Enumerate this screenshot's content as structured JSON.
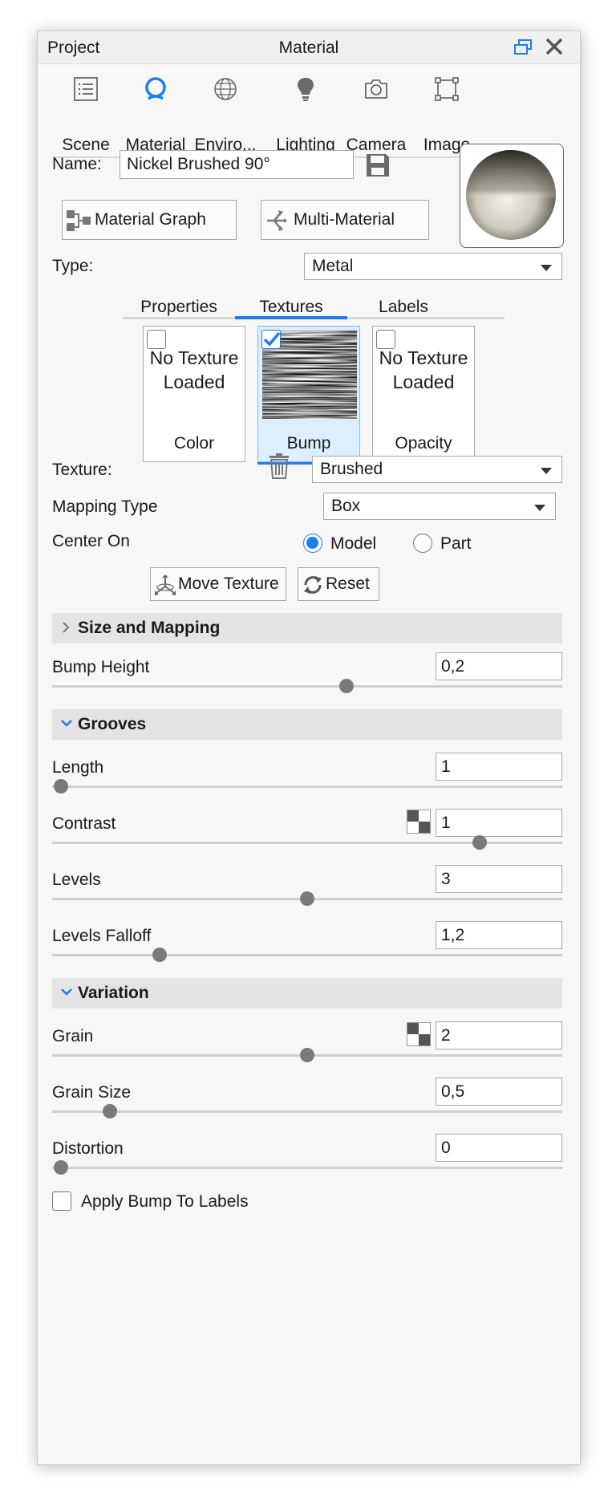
{
  "titlebar": {
    "left": "Project",
    "center": "Material"
  },
  "tabs": [
    {
      "label": "Scene",
      "icon": "list-icon"
    },
    {
      "label": "Material",
      "icon": "material-ring-icon",
      "active": true
    },
    {
      "label": "Enviro...",
      "icon": "globe-icon"
    },
    {
      "label": "Lighting",
      "icon": "lightbulb-icon"
    },
    {
      "label": "Camera",
      "icon": "camera-icon"
    },
    {
      "label": "Image",
      "icon": "image-frame-icon"
    }
  ],
  "name": {
    "label": "Name:",
    "value": "Nickel Brushed 90°"
  },
  "buttons": {
    "material_graph": "Material Graph",
    "multi_material": "Multi-Material",
    "move_texture": "Move Texture",
    "reset": "Reset"
  },
  "type": {
    "label": "Type:",
    "value": "Metal"
  },
  "subtabs": [
    "Properties",
    "Textures",
    "Labels"
  ],
  "texture_slots": [
    {
      "text": "No Texture Loaded",
      "caption": "Color",
      "checked": false
    },
    {
      "caption": "Bump",
      "checked": true
    },
    {
      "text": "No Texture Loaded",
      "caption": "Opacity",
      "checked": false
    }
  ],
  "texture": {
    "label": "Texture:",
    "value": "Brushed"
  },
  "mapping": {
    "label": "Mapping Type",
    "value": "Box"
  },
  "center_on": {
    "label": "Center On",
    "options": [
      "Model",
      "Part"
    ],
    "selected": "Model"
  },
  "sections": {
    "size_mapping": "Size and Mapping",
    "grooves": "Grooves",
    "variation": "Variation"
  },
  "sliders": {
    "bump_height": {
      "label": "Bump Height",
      "value": "0,2",
      "fraction": 0.58
    },
    "length": {
      "label": "Length",
      "value": "1",
      "fraction": 0.0
    },
    "contrast": {
      "label": "Contrast",
      "value": "1",
      "fraction": 0.85
    },
    "levels": {
      "label": "Levels",
      "value": "3",
      "fraction": 0.5
    },
    "levels_falloff": {
      "label": "Levels Falloff",
      "value": "1,2",
      "fraction": 0.2
    },
    "grain": {
      "label": "Grain",
      "value": "2",
      "fraction": 0.5
    },
    "grain_size": {
      "label": "Grain Size",
      "value": "0,5",
      "fraction": 0.1
    },
    "distortion": {
      "label": "Distortion",
      "value": "0",
      "fraction": 0.0
    }
  },
  "apply_bump": {
    "label": "Apply Bump To Labels",
    "checked": false
  },
  "colors": {
    "accent": "#1a7ef2",
    "section_bg": "#e4e4e4",
    "panel_bg": "#f7f7f7"
  }
}
